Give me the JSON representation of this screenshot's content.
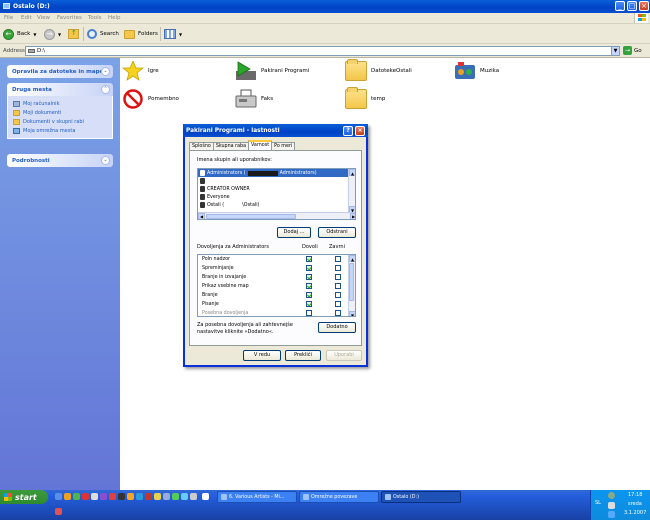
{
  "window": {
    "title": "Ostalo (D:)"
  },
  "menu": [
    "File",
    "Edit",
    "View",
    "Favorites",
    "Tools",
    "Help"
  ],
  "toolbar": {
    "back": "Back",
    "search": "Search",
    "folders": "Folders"
  },
  "address": {
    "label": "Address",
    "value": "D:\\",
    "go": "Go"
  },
  "taskpane": {
    "panel1": {
      "title": "Opravila za datoteke in mape"
    },
    "panel2": {
      "title": "Druga mesta",
      "links": [
        "Moj računalnik",
        "Moji dokumenti",
        "Dokumenti v skupni rabi",
        "Moja omrežna mesta"
      ]
    },
    "panel3": {
      "title": "Podrobnosti"
    }
  },
  "files": [
    {
      "name": "Igre",
      "icon": "star-icon"
    },
    {
      "name": "Pakirani Programi",
      "icon": "installer-icon"
    },
    {
      "name": "DatotekeOstali",
      "icon": "folder-icon"
    },
    {
      "name": "Muzika",
      "icon": "music-icon"
    },
    {
      "name": "Pomembno",
      "icon": "no-entry-icon"
    },
    {
      "name": "Faks",
      "icon": "fax-icon"
    },
    {
      "name": "temp",
      "icon": "folder-icon"
    }
  ],
  "dialog": {
    "title": "Pakirani Programi - lastnosti",
    "tabs": [
      "Splošno",
      "Skupna raba",
      "Varnost",
      "Po meri"
    ],
    "groups_label": "Imena skupin ali uporabnikov:",
    "users": [
      "Administrators (",
      "Administrators)",
      "",
      "CREATOR OWNER",
      "Everyone",
      "Ostali (",
      "\\Ostali)"
    ],
    "add_button": "Dodaj ...",
    "remove_button": "Odstrani",
    "perm_label": "Dovoljenja za Administrators",
    "allow_label": "Dovoli",
    "deny_label": "Zavrni",
    "permissions": [
      {
        "name": "Poln nadzor",
        "allow": true,
        "deny": false
      },
      {
        "name": "Spreminjanje",
        "allow": true,
        "deny": false
      },
      {
        "name": "Branje in izvajanje",
        "allow": true,
        "deny": false
      },
      {
        "name": "Prikaz vsebine map",
        "allow": true,
        "deny": false
      },
      {
        "name": "Branje",
        "allow": true,
        "deny": false
      },
      {
        "name": "Pisanje",
        "allow": true,
        "deny": false
      },
      {
        "name": "Posebna dovoljenja",
        "allow": false,
        "deny": false
      }
    ],
    "advanced_text_1": "Za posebna dovoljenja ali zahtevnejše",
    "advanced_text_2": "nastavitve kliknite »Dodatno«.",
    "advanced_button": "Dodatno",
    "ok": "V redu",
    "cancel": "Prekliči",
    "apply": "Uporabi"
  },
  "taskbar": {
    "start": "start",
    "items": [
      "6. Various Artists - Mi...",
      "Omrežne povezave",
      "Ostalo (D:)"
    ],
    "tray": {
      "lang": "SL",
      "time": "17:18",
      "day": "sreda",
      "date": "3.1.2007"
    }
  },
  "colors": {
    "xp_blue": "#0a50d0",
    "taskpane": "#6f8fdf",
    "selection": "#316ac5",
    "start_green": "#3c9a3c"
  }
}
